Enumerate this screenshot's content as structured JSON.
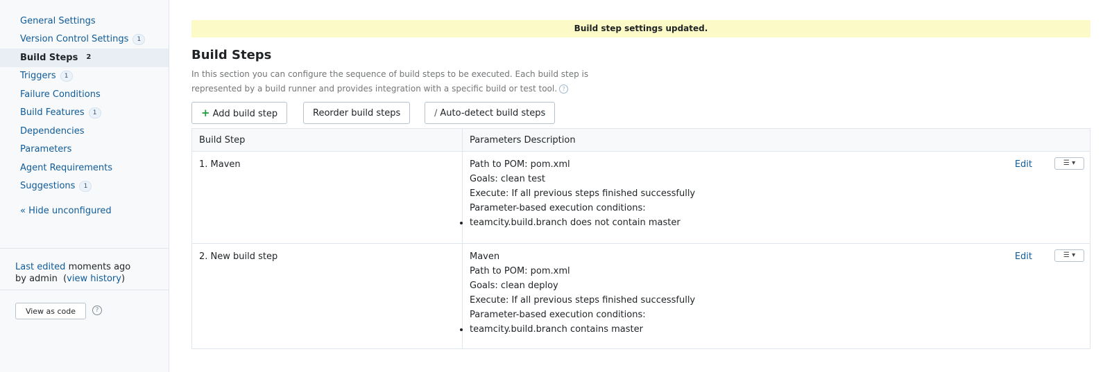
{
  "sidebar": {
    "items": [
      {
        "label": "General Settings",
        "badge": ""
      },
      {
        "label": "Version Control Settings",
        "badge": "1"
      },
      {
        "label": "Build Steps",
        "badge": "2"
      },
      {
        "label": "Triggers",
        "badge": "1"
      },
      {
        "label": "Failure Conditions",
        "badge": ""
      },
      {
        "label": "Build Features",
        "badge": "1"
      },
      {
        "label": "Dependencies",
        "badge": ""
      },
      {
        "label": "Parameters",
        "badge": ""
      },
      {
        "label": "Agent Requirements",
        "badge": ""
      },
      {
        "label": "Suggestions",
        "badge": "1"
      }
    ],
    "active_index": 2,
    "hide_unconfigured": "« Hide unconfigured",
    "last_edited_prefix": "Last edited",
    "last_edited_time": "moments ago",
    "by_user": "by admin",
    "view_history": "view history",
    "view_as_code": "View as code"
  },
  "notice": "Build step settings updated.",
  "page_title": "Build Steps",
  "description": "In this section you can configure the sequence of build steps to be executed. Each build step is represented by a build runner and provides integration with a specific build or test tool.",
  "buttons": {
    "add": "Add build step",
    "reorder": "Reorder build steps",
    "autodetect": "Auto-detect build steps"
  },
  "table": {
    "headers": [
      "Build Step",
      "Parameters Description"
    ],
    "edit_label": "Edit",
    "rows": [
      {
        "name": "1. Maven",
        "lines": [
          "Path to POM: pom.xml",
          "Goals: clean test",
          "Execute: If all previous steps finished successfully",
          "Parameter-based execution conditions:"
        ],
        "conditions": [
          "teamcity.build.branch does not contain master"
        ]
      },
      {
        "name": "2. New build step",
        "lines": [
          "Maven",
          "Path to POM: pom.xml",
          "Goals: clean deploy",
          "Execute: If all previous steps finished successfully",
          "Parameter-based execution conditions:"
        ],
        "conditions": [
          "teamcity.build.branch contains master"
        ]
      }
    ]
  },
  "colors": {
    "link": "#0f5b99",
    "notice_bg": "#fcfac6",
    "plus": "#1f9d3c"
  }
}
